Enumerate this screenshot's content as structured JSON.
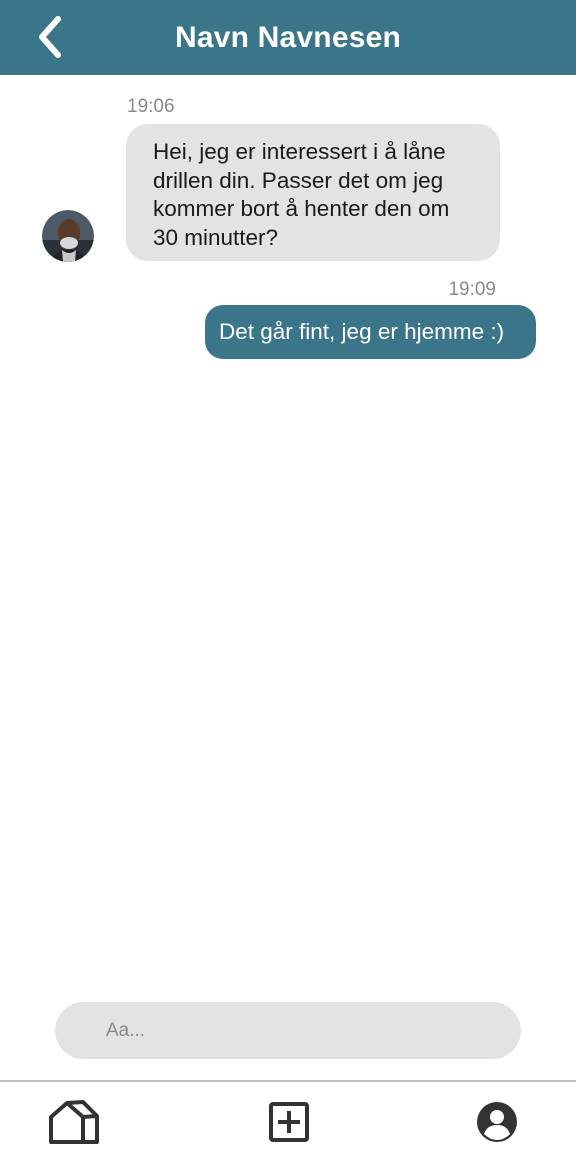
{
  "header": {
    "title": "Navn Navnesen",
    "back_icon": "chevron-left-icon",
    "background": "#3a7589"
  },
  "messages": [
    {
      "direction": "incoming",
      "time": "19:06",
      "text": "Hei, jeg er interessert i å låne drillen din. Passer det om jeg kommer bort å henter den om 30 minutter?",
      "avatar": "contact-avatar"
    },
    {
      "direction": "outgoing",
      "time": "19:09",
      "text": "Det går fint, jeg er hjemme :)"
    }
  ],
  "composer": {
    "placeholder": "Aa..."
  },
  "bottom_nav": {
    "items": [
      {
        "icon": "home-icon"
      },
      {
        "icon": "add-square-icon"
      },
      {
        "icon": "profile-icon"
      }
    ]
  },
  "colors": {
    "accent": "#3a7589",
    "incoming_bubble": "#e3e3e3",
    "timestamp": "#8a8a8a"
  }
}
